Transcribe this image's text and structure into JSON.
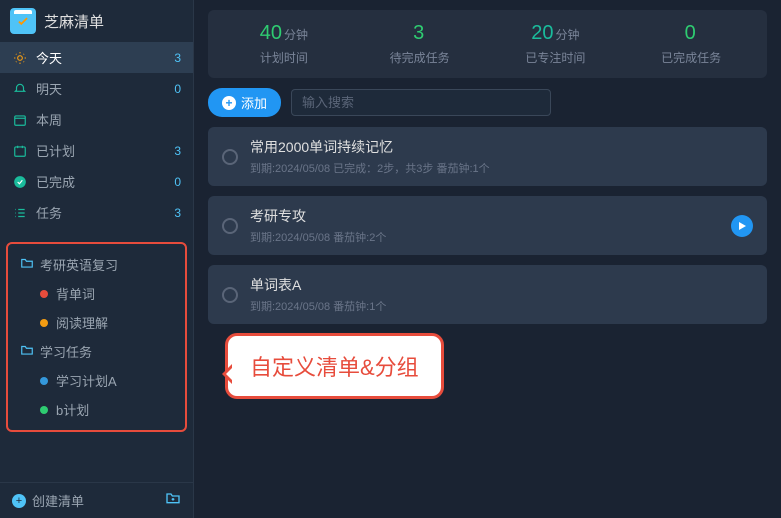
{
  "app": {
    "title": "芝麻清单"
  },
  "nav": [
    {
      "icon": "sun",
      "label": "今天",
      "count": "3",
      "active": true
    },
    {
      "icon": "bell",
      "label": "明天",
      "count": "0"
    },
    {
      "icon": "calendar",
      "label": "本周",
      "count": ""
    },
    {
      "icon": "calendar2",
      "label": "已计划",
      "count": "3"
    },
    {
      "icon": "check",
      "label": "已完成",
      "count": "0"
    },
    {
      "icon": "list",
      "label": "任务",
      "count": "3"
    }
  ],
  "folders": [
    {
      "name": "考研英语复习",
      "items": [
        {
          "dot": "red",
          "label": "背单词"
        },
        {
          "dot": "yellow",
          "label": "阅读理解"
        }
      ]
    },
    {
      "name": "学习任务",
      "items": [
        {
          "dot": "blue",
          "label": "学习计划A"
        },
        {
          "dot": "green",
          "label": "b计划"
        }
      ]
    }
  ],
  "footer": {
    "create": "创建清单"
  },
  "stats": [
    {
      "value": "40",
      "unit": "分钟",
      "label": "计划时间",
      "color": "green"
    },
    {
      "value": "3",
      "unit": "",
      "label": "待完成任务",
      "color": "green"
    },
    {
      "value": "20",
      "unit": "分钟",
      "label": "已专注时间",
      "color": "cyan"
    },
    {
      "value": "0",
      "unit": "",
      "label": "已完成任务",
      "color": "green"
    }
  ],
  "toolbar": {
    "add": "添加",
    "search_placeholder": "输入搜索"
  },
  "tasks": [
    {
      "title": "常用2000单词持续记忆",
      "meta": "到期:2024/05/08 已完成：2步，共3步 番茄钟:1个",
      "play": false
    },
    {
      "title": "考研专攻",
      "meta": "到期:2024/05/08  番茄钟:2个",
      "play": true
    },
    {
      "title": "单词表A",
      "meta": "到期:2024/05/08  番茄钟:1个",
      "play": false
    }
  ],
  "callout": "自定义清单&分组"
}
